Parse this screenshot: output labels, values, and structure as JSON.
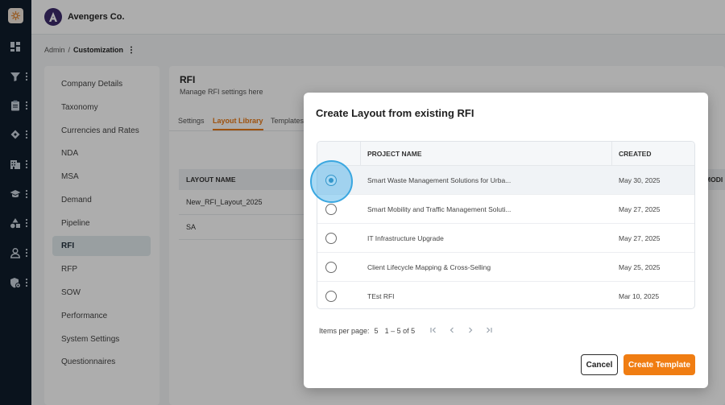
{
  "app": {
    "company": "Avengers Co."
  },
  "breadcrumb": {
    "parent": "Admin",
    "separator": "/",
    "current": "Customization"
  },
  "rail": {
    "items": [
      {
        "icon": "dashboard-icon"
      },
      {
        "icon": "funnel-icon"
      },
      {
        "icon": "clipboard-icon"
      },
      {
        "icon": "handshake-icon"
      },
      {
        "icon": "building-icon"
      },
      {
        "icon": "graduation-cap-icon"
      },
      {
        "icon": "shapes-icon"
      },
      {
        "icon": "user-icon"
      },
      {
        "icon": "shield-gear-icon"
      }
    ]
  },
  "settings_nav": {
    "items": [
      {
        "label": "Company Details",
        "active": false
      },
      {
        "label": "Taxonomy",
        "active": false
      },
      {
        "label": "Currencies and Rates",
        "active": false
      },
      {
        "label": "NDA",
        "active": false
      },
      {
        "label": "MSA",
        "active": false
      },
      {
        "label": "Demand",
        "active": false
      },
      {
        "label": "Pipeline",
        "active": false
      },
      {
        "label": "RFI",
        "active": true
      },
      {
        "label": "RFP",
        "active": false
      },
      {
        "label": "SOW",
        "active": false
      },
      {
        "label": "Performance",
        "active": false
      },
      {
        "label": "System Settings",
        "active": false
      },
      {
        "label": "Questionnaires",
        "active": false
      }
    ]
  },
  "panel": {
    "title": "RFI",
    "subtitle": "Manage RFI settings here",
    "tabs": [
      {
        "label": "Settings",
        "active": false
      },
      {
        "label": "Layout Library",
        "active": true
      },
      {
        "label": "Templates",
        "active": false
      }
    ],
    "library_table": {
      "header": "LAYOUT NAME",
      "right_header_partial": "MODI",
      "rows": [
        "New_RFI_Layout_2025",
        "SA"
      ]
    }
  },
  "modal": {
    "title": "Create Layout from existing RFI",
    "columns": {
      "project_name": "PROJECT NAME",
      "created": "CREATED"
    },
    "rows": [
      {
        "name": "Smart Waste Management Solutions for Urba...",
        "created": "May 30, 2025",
        "selected": true
      },
      {
        "name": "Smart Mobility and Traffic Management Soluti...",
        "created": "May 27, 2025",
        "selected": false
      },
      {
        "name": "IT Infrastructure Upgrade",
        "created": "May 27, 2025",
        "selected": false
      },
      {
        "name": "Client Lifecycle Mapping & Cross-Selling",
        "created": "May 25, 2025",
        "selected": false
      },
      {
        "name": "TEst RFI",
        "created": "Mar 10, 2025",
        "selected": false
      }
    ],
    "pagination": {
      "items_per_page_label": "Items per page:",
      "items_per_page_value": "5",
      "range": "1 – 5 of 5"
    },
    "buttons": {
      "cancel": "Cancel",
      "create": "Create Template"
    }
  },
  "colors": {
    "accent": "#f07d12",
    "rail_bg": "#0f1c2b",
    "selected_radio": "#2a86b4"
  }
}
